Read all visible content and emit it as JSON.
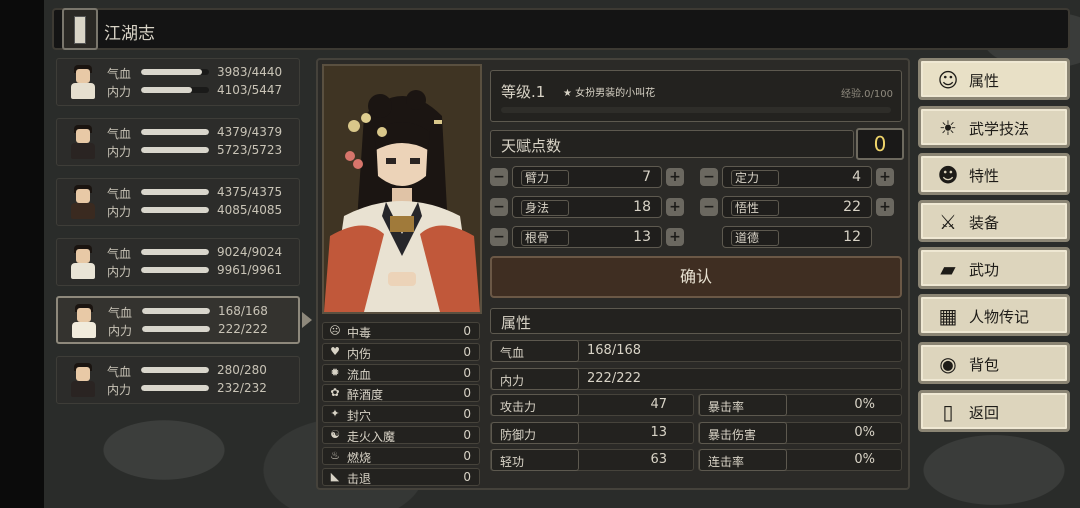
{
  "header": {
    "title": "江湖志"
  },
  "characters": [
    {
      "hp_label": "气血",
      "hp_value": "3983/4440",
      "hp_fill": 0.9,
      "mp_label": "内力",
      "mp_value": "4103/5447",
      "mp_fill": 0.75,
      "body_color": "#e6dfcf"
    },
    {
      "hp_label": "气血",
      "hp_value": "4379/4379",
      "hp_fill": 1.0,
      "mp_label": "内力",
      "mp_value": "5723/5723",
      "mp_fill": 1.0,
      "body_color": "#2a2422"
    },
    {
      "hp_label": "气血",
      "hp_value": "4375/4375",
      "hp_fill": 1.0,
      "mp_label": "内力",
      "mp_value": "4085/4085",
      "mp_fill": 1.0,
      "body_color": "#3a2a20"
    },
    {
      "hp_label": "气血",
      "hp_value": "9024/9024",
      "hp_fill": 1.0,
      "mp_label": "内力",
      "mp_value": "9961/9961",
      "mp_fill": 1.0,
      "body_color": "#e9e4d6"
    },
    {
      "hp_label": "气血",
      "hp_value": "168/168",
      "hp_fill": 1.0,
      "mp_label": "内力",
      "mp_value": "222/222",
      "mp_fill": 1.0,
      "body_color": "#f1ebdc"
    },
    {
      "hp_label": "气血",
      "hp_value": "280/280",
      "hp_fill": 1.0,
      "mp_label": "内力",
      "mp_value": "232/232",
      "mp_fill": 1.0,
      "body_color": "#2a2422"
    }
  ],
  "status_effects": [
    {
      "icon": "☹",
      "name": "中毒",
      "value": "0"
    },
    {
      "icon": "♥",
      "name": "内伤",
      "value": "0"
    },
    {
      "icon": "✹",
      "name": "流血",
      "value": "0"
    },
    {
      "icon": "✿",
      "name": "醉酒度",
      "value": "0"
    },
    {
      "icon": "✦",
      "name": "封穴",
      "value": "0"
    },
    {
      "icon": "☯",
      "name": "走火入魔",
      "value": "0"
    },
    {
      "icon": "♨",
      "name": "燃烧",
      "value": "0"
    },
    {
      "icon": "◣",
      "name": "击退",
      "value": "0"
    }
  ],
  "level": {
    "label": "等级.1",
    "tag": "★ 女扮男装的小叫花",
    "exp": "经验.0/100"
  },
  "talent": {
    "label": "天赋点数",
    "value": "0"
  },
  "attributes": [
    {
      "name": "臂力",
      "value": "7",
      "adjustable": true
    },
    {
      "name": "定力",
      "value": "4",
      "adjustable": true
    },
    {
      "name": "身法",
      "value": "18",
      "adjustable": true
    },
    {
      "name": "悟性",
      "value": "22",
      "adjustable": true
    },
    {
      "name": "根骨",
      "value": "13",
      "adjustable": true
    },
    {
      "name": "道德",
      "value": "12",
      "adjustable": false
    }
  ],
  "confirm_label": "确认",
  "properties_title": "属性",
  "properties": {
    "hp": {
      "name": "气血",
      "value": "168/168"
    },
    "mp": {
      "name": "内力",
      "value": "222/222"
    },
    "attack": {
      "name": "攻击力",
      "value": "47"
    },
    "crit_rate": {
      "name": "暴击率",
      "value": "0%"
    },
    "defense": {
      "name": "防御力",
      "value": "13"
    },
    "crit_damage": {
      "name": "暴击伤害",
      "value": "0%"
    },
    "qinggong": {
      "name": "轻功",
      "value": "63"
    },
    "combo_rate": {
      "name": "连击率",
      "value": "0%"
    }
  },
  "menu": [
    {
      "icon": "☺",
      "label": "属性",
      "name": "menu-attributes"
    },
    {
      "icon": "☀",
      "label": "武学技法",
      "name": "menu-martial-skills"
    },
    {
      "icon": "☻",
      "label": "特性",
      "name": "menu-traits"
    },
    {
      "icon": "⚔",
      "label": "装备",
      "name": "menu-equipment"
    },
    {
      "icon": "▰",
      "label": "武功",
      "name": "menu-kungfu"
    },
    {
      "icon": "▦",
      "label": "人物传记",
      "name": "menu-biography"
    },
    {
      "icon": "◉",
      "label": "背包",
      "name": "menu-backpack"
    },
    {
      "icon": "▯",
      "label": "返回",
      "name": "menu-back"
    }
  ]
}
